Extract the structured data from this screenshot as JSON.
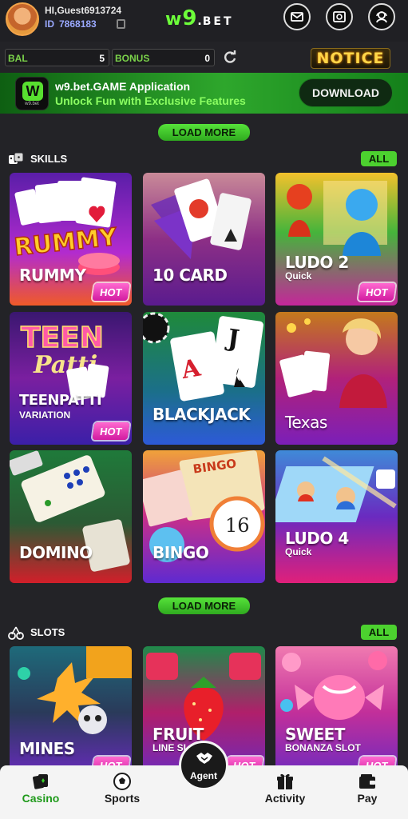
{
  "header": {
    "greeting": "HI,Guest6913724",
    "id_label": "ID",
    "id_value": "7868183",
    "logo_w": "w",
    "logo_nine": "9",
    "logo_dot": ".",
    "logo_bet": "BET",
    "icons": [
      "mail-icon",
      "wallet-icon",
      "support-icon"
    ]
  },
  "balance": {
    "bal_label": "BAL",
    "bal_value": "5",
    "bonus_label": "BONUS",
    "bonus_value": "0",
    "notice_label": "NOTICE"
  },
  "banner": {
    "app_icon_letter": "W",
    "app_icon_caption": "w9.bet",
    "title": "w9.bet.GAME Application",
    "subtitle": "Unlock Fun with Exclusive Features",
    "download_label": "DOWNLOAD"
  },
  "load_more_label": "LOAD MORE",
  "sections": {
    "skills": {
      "title": "SKILLS",
      "all_label": "ALL",
      "games": [
        {
          "title": "RUMMY",
          "sub": "",
          "hot": "HOT"
        },
        {
          "title": "10 CARD",
          "sub": "",
          "hot": ""
        },
        {
          "title": "LUDO 2",
          "sub": "Quick",
          "hot": "HOT"
        },
        {
          "title": "TEENPATTI",
          "sub": "VARIATION",
          "hot": "HOT"
        },
        {
          "title": "BLACKJACK",
          "sub": "",
          "hot": ""
        },
        {
          "title": "Texas",
          "sub": "",
          "hot": ""
        },
        {
          "title": "DOMINO",
          "sub": "",
          "hot": ""
        },
        {
          "title": "BINGO",
          "sub": "",
          "hot": ""
        },
        {
          "title": "LUDO 4",
          "sub": "Quick",
          "hot": ""
        }
      ]
    },
    "slots": {
      "title": "SLOTS",
      "all_label": "ALL",
      "games": [
        {
          "title": "MINES",
          "sub": "",
          "hot": "HOT"
        },
        {
          "title": "FRUIT",
          "sub": "LINE SL",
          "hot": "HOT"
        },
        {
          "title": "SWEET",
          "sub": "BONANZA SLOT",
          "hot": "HOT"
        }
      ]
    }
  },
  "card_art_text": {
    "rummy": "RUMMY",
    "teen": "TEEN",
    "patti": "Patti",
    "bingo": "BINGO",
    "ball": "16"
  },
  "nav": {
    "casino": "Casino",
    "sports": "Sports",
    "agent": "Agent",
    "activity": "Activity",
    "pay": "Pay"
  },
  "colors": {
    "accent_green": "#4cd12f",
    "hot_pink": "#d21aa0",
    "active_nav": "#1f9a1b"
  }
}
